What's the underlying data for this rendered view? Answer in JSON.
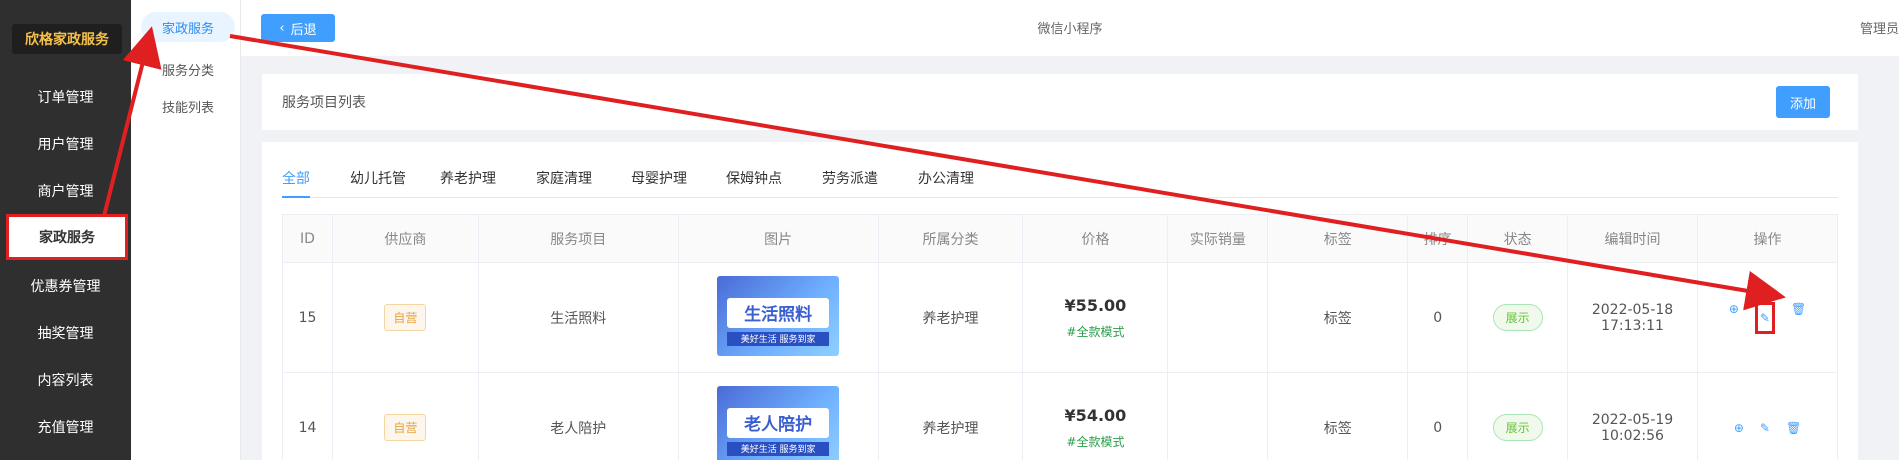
{
  "sidebar": {
    "brand": "欣格家政服务",
    "items": [
      {
        "label": "订单管理"
      },
      {
        "label": "用户管理"
      },
      {
        "label": "商户管理"
      },
      {
        "label": "家政服务"
      },
      {
        "label": "优惠券管理"
      },
      {
        "label": "抽奖管理"
      },
      {
        "label": "内容列表"
      },
      {
        "label": "充值管理"
      }
    ]
  },
  "submenu": {
    "items": [
      {
        "label": "家政服务"
      },
      {
        "label": "服务分类"
      },
      {
        "label": "技能列表"
      }
    ]
  },
  "topbar": {
    "back_label": "后退",
    "title": "微信小程序",
    "admin": "管理员"
  },
  "header": {
    "title": "服务项目列表",
    "add_label": "添加"
  },
  "tabs": [
    "全部",
    "幼儿托管",
    "养老护理",
    "家庭清理",
    "母婴护理",
    "保姆钟点",
    "劳务派遣",
    "办公清理"
  ],
  "table": {
    "columns": [
      "ID",
      "供应商",
      "服务项目",
      "图片",
      "所属分类",
      "价格",
      "实际销量",
      "标签",
      "排序",
      "状态",
      "编辑时间",
      "操作"
    ],
    "rows": [
      {
        "id": "15",
        "supplier": "自营",
        "item": "生活照料",
        "image_title": "生活照料",
        "image_sub": "美好生活 服务到家",
        "category": "养老护理",
        "price": "¥55.00",
        "mode": "#全款模式",
        "sales": "",
        "tag": "标签",
        "sort": "0",
        "status": "展示",
        "time": "2022-05-18 17:13:11"
      },
      {
        "id": "14",
        "supplier": "自营",
        "item": "老人陪护",
        "image_title": "老人陪护",
        "image_sub": "美好生活 服务到家",
        "category": "养老护理",
        "price": "¥54.00",
        "mode": "#全款模式",
        "sales": "",
        "tag": "标签",
        "sort": "0",
        "status": "展示",
        "time": "2022-05-19 10:02:56"
      }
    ]
  },
  "icons": {
    "add": "plus-circle-icon",
    "edit": "edit-icon",
    "delete": "trash-icon"
  },
  "annotation_color": "#e02020",
  "accent": "#409eff"
}
